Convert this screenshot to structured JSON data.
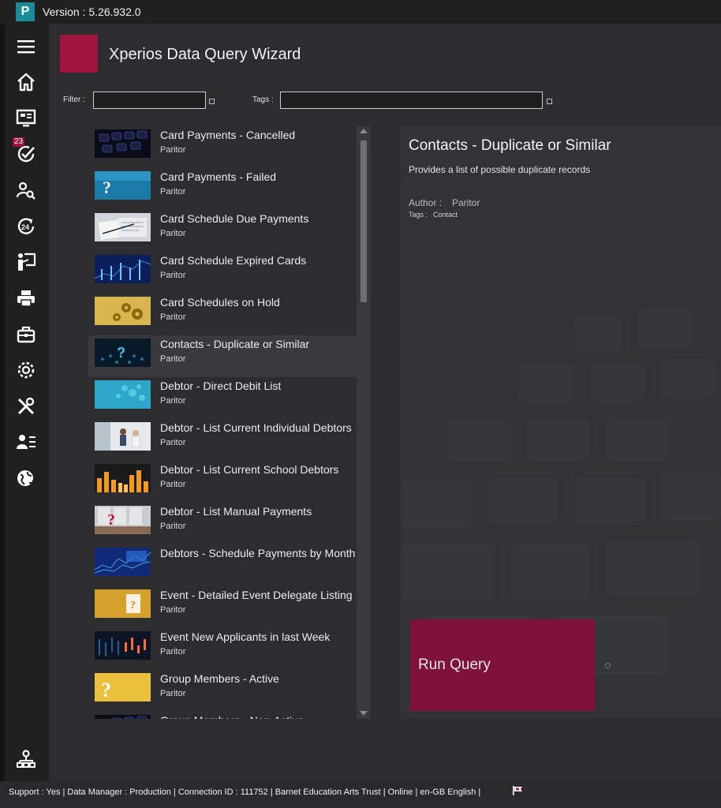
{
  "app": {
    "logo_letter": "P",
    "version_label": "Version : 5.26.932.0"
  },
  "nav": {
    "badge_count": "23",
    "items": [
      "menu-icon",
      "home-icon",
      "monitor-icon",
      "task-check-icon",
      "search-person-icon",
      "24h-icon",
      "presenter-icon",
      "print-icon",
      "briefcase-icon",
      "settings-icon",
      "tools-icon",
      "user-list-icon",
      "globe-icon"
    ],
    "bottom_item": "org-chart-icon"
  },
  "header": {
    "title": "Xperios Data Query Wizard",
    "accent_color": "#a0153e"
  },
  "filters": {
    "filter_label": "Filter :",
    "filter_value": "",
    "tags_label": "Tags :",
    "tags_value": ""
  },
  "queries": [
    {
      "title": "Card Payments - Cancelled",
      "author": "Paritor",
      "thumb": "keyboard-dark"
    },
    {
      "title": "Card Payments - Failed",
      "author": "Paritor",
      "thumb": "question-blue"
    },
    {
      "title": "Card Schedule Due Payments",
      "author": "Paritor",
      "thumb": "documents-light"
    },
    {
      "title": "Card Schedule Expired Cards",
      "author": "Paritor",
      "thumb": "data-blue"
    },
    {
      "title": "Card Schedules on Hold",
      "author": "Paritor",
      "thumb": "gears-gold"
    },
    {
      "title": "Contacts - Duplicate or Similar",
      "author": "Paritor",
      "thumb": "question-teal",
      "selected": true
    },
    {
      "title": "Debtor - Direct Debit List",
      "author": "Paritor",
      "thumb": "cells-cyan"
    },
    {
      "title": "Debtor - List Current Individual Debtors",
      "author": "Paritor",
      "thumb": "people-light"
    },
    {
      "title": "Debtor - List Current School Debtors",
      "author": "Paritor",
      "thumb": "bars-orange"
    },
    {
      "title": "Debtor - List Manual Payments",
      "author": "Paritor",
      "thumb": "question-grey"
    },
    {
      "title": "Debtors - Schedule Payments by Month",
      "author": "",
      "thumb": "graph-blue"
    },
    {
      "title": "Event - Detailed Event Delegate Listing",
      "author": "Paritor",
      "thumb": "note-gold"
    },
    {
      "title": "Event New Applicants in last Week",
      "author": "Paritor",
      "thumb": "candles-dark"
    },
    {
      "title": "Group Members - Active",
      "author": "Paritor",
      "thumb": "question-yellow"
    },
    {
      "title": "Group Members - Non-Active",
      "author": "",
      "thumb": "keyboard-dark"
    }
  ],
  "detail": {
    "title": "Contacts - Duplicate or Similar",
    "description": "Provides a list of possible duplicate records",
    "author_label": "Author :",
    "author_value": "Paritor",
    "tags_label": "Tags :",
    "tags_value": "Contact",
    "run_label": "Run Query"
  },
  "status": {
    "text": "Support : Yes | Data Manager : Production |  Connection ID : 111752 |  Barnet Education Arts Trust |  Online |  en-GB  English  |"
  }
}
